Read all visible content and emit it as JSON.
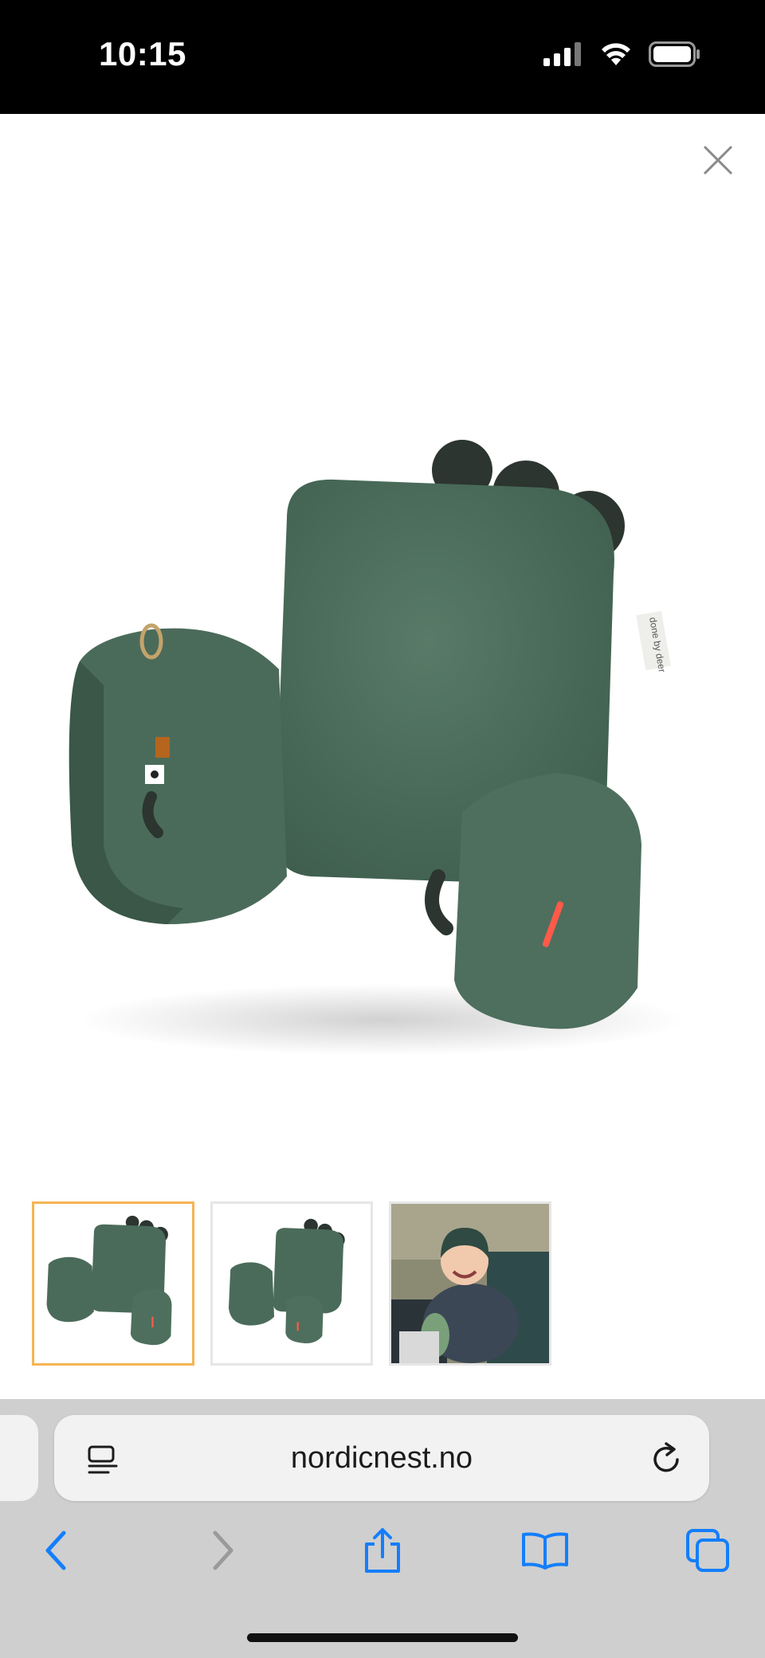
{
  "status_bar": {
    "time": "10:15",
    "icons": [
      "cellular-signal-icon",
      "wifi-icon",
      "battery-icon"
    ]
  },
  "viewer": {
    "close_icon": "close-icon",
    "main_image": "Green dinosaur support pillow with spikes and armrests",
    "thumbnails": [
      {
        "name": "thumbnail-pillow-front",
        "active": true
      },
      {
        "name": "thumbnail-pillow-angle",
        "active": false
      },
      {
        "name": "thumbnail-baby-in-stroller",
        "active": false
      }
    ],
    "tag_text": "done by deer"
  },
  "browser": {
    "url": "nordicnest.no",
    "toolbar": [
      "back-icon",
      "forward-icon",
      "share-icon",
      "bookmarks-icon",
      "tabs-icon"
    ]
  },
  "colors": {
    "accent": "#147efb",
    "thumb_active_border": "#f5b453",
    "pillow_green": "#4b6b5a"
  }
}
